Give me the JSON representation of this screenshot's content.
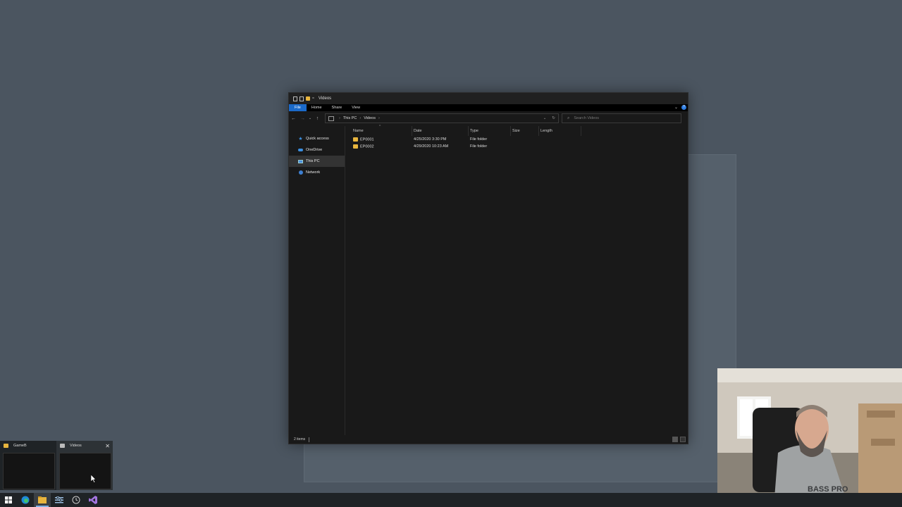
{
  "explorer": {
    "title": "Videos",
    "ribbon_tabs": [
      "File",
      "Home",
      "Share",
      "View"
    ],
    "breadcrumb": [
      "This PC",
      "Videos"
    ],
    "search_placeholder": "Search Videos",
    "nav_items": [
      {
        "label": "Quick access",
        "icon": "star-icon"
      },
      {
        "label": "OneDrive",
        "icon": "cloud-icon"
      },
      {
        "label": "This PC",
        "icon": "computer-icon",
        "selected": true
      },
      {
        "label": "Network",
        "icon": "network-icon"
      }
    ],
    "columns": [
      "Name",
      "Date",
      "Type",
      "Size",
      "Length"
    ],
    "rows": [
      {
        "name": "EP0001",
        "date": "4/25/2020 3:30 PM",
        "type": "File folder"
      },
      {
        "name": "EP0002",
        "date": "4/29/2020 10:23 AM",
        "type": "File folder"
      }
    ],
    "status": "2 items"
  },
  "taskbar": {
    "previews": [
      {
        "title": "GameB",
        "icon": "folder-icon"
      },
      {
        "title": "Videos",
        "icon": "folder-icon"
      }
    ],
    "icons": [
      "windows-start-icon",
      "edge-icon",
      "file-explorer-icon",
      "settings-icon",
      "clock-icon",
      "visual-studio-icon"
    ]
  },
  "colors": {
    "desktop": "#4b5560",
    "explorer_bg": "#191919",
    "accent": "#1b6ac9",
    "folder": "#e8b53e"
  }
}
